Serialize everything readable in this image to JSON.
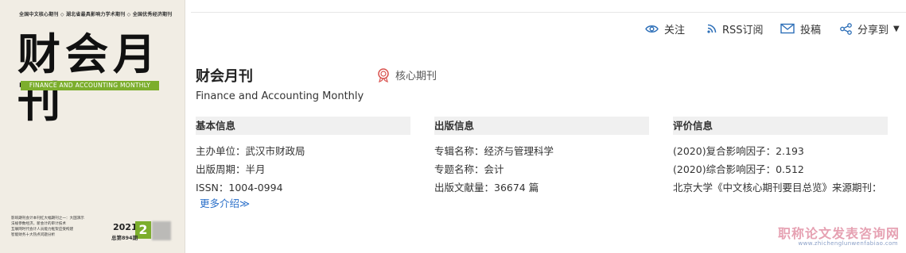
{
  "cover": {
    "top_line": "全国中文核心期刊 ◇ 湖北省最具影响力学术期刊 ◇ 全国优秀经济期刊",
    "title": "财会月刊",
    "english_band": "FINANCE AND ACCOUNTING MONTHLY",
    "lines": [
      "影响期刊会计本刊红大幅期刊之一：大国演示",
      "法规参数经济，新会计的审计技术",
      "互联网时代会计人员能力框架应受构建",
      "智能财务十大热点问题分析"
    ],
    "year": "2021",
    "issue": "2",
    "total_issue": "总第894期"
  },
  "toolbar": {
    "follow": "关注",
    "rss": "RSS订阅",
    "submit": "投稿",
    "share": "分享到"
  },
  "journal": {
    "title": "财会月刊",
    "badge": "核心期刊",
    "english": "Finance and Accounting Monthly"
  },
  "basic_info": {
    "heading": "基本信息",
    "rows": [
      "主办单位：武汉市财政局",
      "出版周期：半月",
      "ISSN：1004-0994"
    ],
    "more": "更多介绍≫"
  },
  "publish_info": {
    "heading": "出版信息",
    "rows": [
      "专辑名称：经济与管理科学",
      "专题名称：会计",
      "出版文献量：36674 篇"
    ]
  },
  "eval_info": {
    "heading": "评价信息",
    "rows": [
      "(2020)复合影响因子：2.193",
      "(2020)综合影响因子：0.512",
      "北京大学《中文核心期刊要目总览》来源期刊："
    ]
  },
  "watermark": {
    "cn": "职称论文发表咨询网",
    "en": "www.zhichenglunwenfabiao.com"
  },
  "colors": {
    "cover_green": "#7cae2d",
    "link_blue": "#2a6fc9",
    "icon_blue": "#2d6fb8",
    "badge_red": "#d9534f"
  }
}
